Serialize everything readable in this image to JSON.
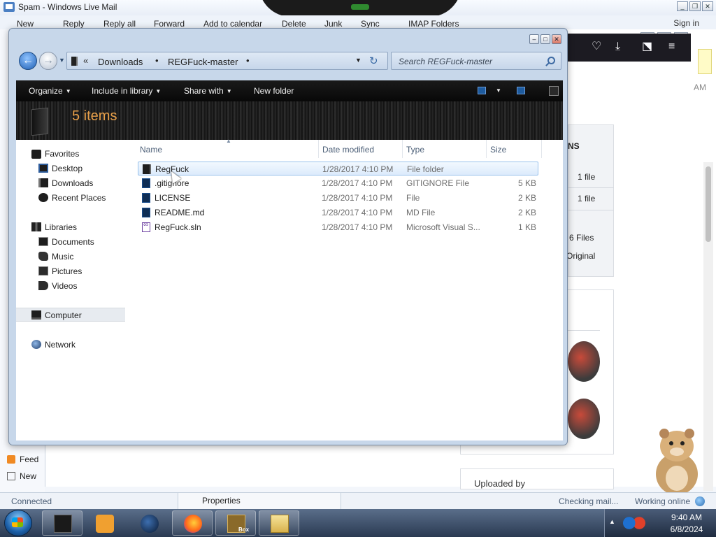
{
  "mail": {
    "title": "Spam - Windows Live Mail",
    "sign_in": "Sign in",
    "menu": [
      "New",
      "Reply",
      "Reply all",
      "Forward",
      "Add to calendar",
      "Delete",
      "Junk",
      "Sync",
      "IMAP Folders"
    ],
    "left_items": [
      "Feed",
      "New"
    ],
    "status": {
      "connected": "Connected",
      "properties": "Properties",
      "checking": "Checking mail...",
      "working": "Working online"
    }
  },
  "browser": {
    "am_fragment": "AM",
    "side_heading": "NS",
    "side_rows": [
      "1 file",
      "1 file",
      "6 Files",
      "Original"
    ],
    "uploaded_by": "Uploaded by"
  },
  "explorer": {
    "breadcrumb": [
      "Downloads",
      "REGFuck-master"
    ],
    "search_placeholder": "Search REGFuck-master",
    "commands": {
      "organize": "Organize",
      "include_in_library": "Include in library",
      "share_with": "Share with",
      "new_folder": "New folder"
    },
    "items_count": "5 items",
    "nav": {
      "favorites": "Favorites",
      "desktop": "Desktop",
      "downloads": "Downloads",
      "recent_places": "Recent Places",
      "libraries": "Libraries",
      "documents": "Documents",
      "music": "Music",
      "pictures": "Pictures",
      "videos": "Videos",
      "computer": "Computer",
      "network": "Network"
    },
    "columns": {
      "name": "Name",
      "date_modified": "Date modified",
      "type": "Type",
      "size": "Size"
    },
    "files": [
      {
        "name": "RegFuck",
        "date": "1/28/2017 4:10 PM",
        "type": "File folder",
        "size": "",
        "icon": "folder-icon",
        "selected": true
      },
      {
        "name": ".gitignore",
        "date": "1/28/2017 4:10 PM",
        "type": "GITIGNORE File",
        "size": "5 KB",
        "icon": "file-icon",
        "selected": false
      },
      {
        "name": "LICENSE",
        "date": "1/28/2017 4:10 PM",
        "type": "File",
        "size": "2 KB",
        "icon": "file-icon",
        "selected": false
      },
      {
        "name": "README.md",
        "date": "1/28/2017 4:10 PM",
        "type": "MD File",
        "size": "2 KB",
        "icon": "file-icon",
        "selected": false
      },
      {
        "name": "RegFuck.sln",
        "date": "1/28/2017 4:10 PM",
        "type": "Microsoft Visual S...",
        "size": "1 KB",
        "icon": "visual-studio-solution-icon",
        "selected": false
      }
    ]
  },
  "taskbar": {
    "time": "9:40 AM",
    "date": "6/8/2024",
    "box_label": "Box"
  },
  "colors": {
    "items_count": "#e8a04a",
    "selection_border": "#99c2ec",
    "command_bar": "#101010"
  }
}
